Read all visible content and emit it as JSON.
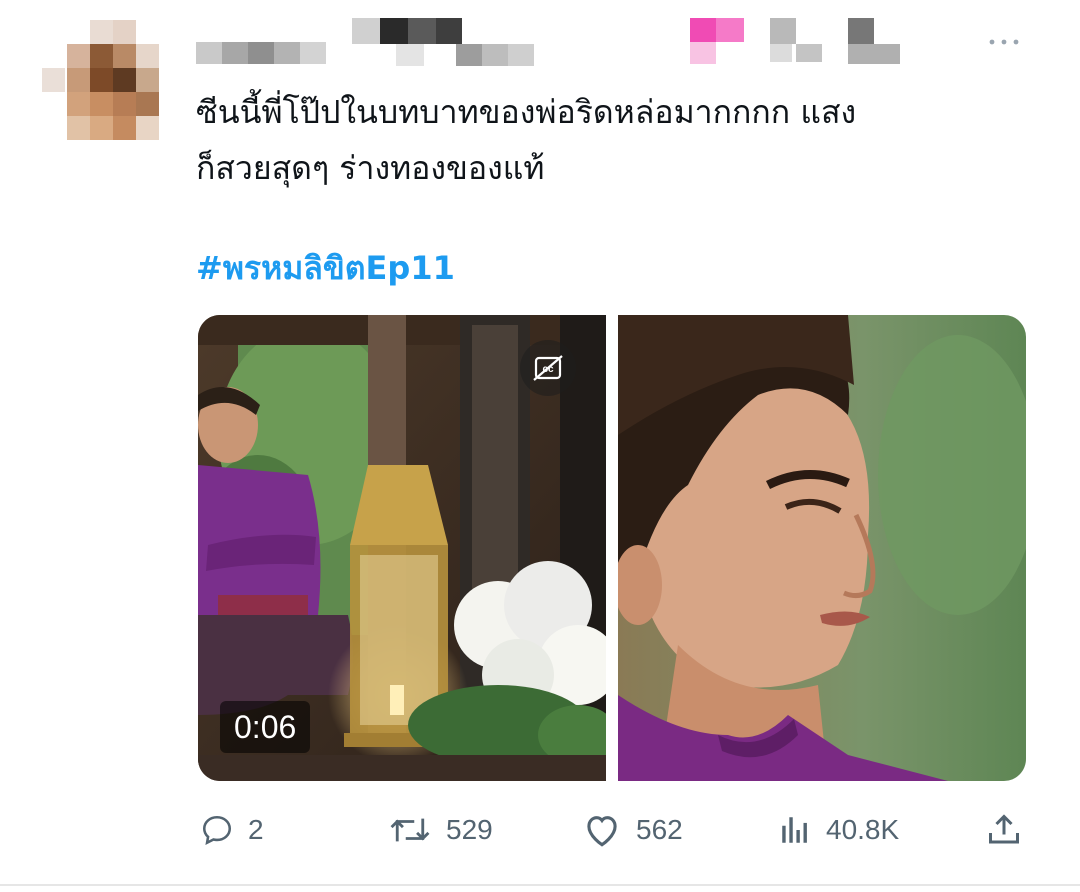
{
  "tweet": {
    "text_lines": [
      "ซีนนี้พี่โป๊ปในบทบาทของพ่อริดหล่อมากกกก แสง",
      "ก็สวยสุดๆ ร่างทองของแท้"
    ],
    "hashtag": "#พรหมลิขิตEp11",
    "more_icon": "more-dots-icon"
  },
  "media": {
    "video_duration": "0:06",
    "caption_icon": "closed-captions-off-icon"
  },
  "actions": {
    "replies": "2",
    "retweets": "529",
    "likes": "562",
    "views": "40.8K",
    "icons": [
      "reply-icon",
      "retweet-icon",
      "like-icon",
      "views-icon",
      "share-icon"
    ]
  },
  "colors": {
    "hashtag": "#1d9bf0",
    "text": "#0f1419",
    "muted": "#536471"
  }
}
